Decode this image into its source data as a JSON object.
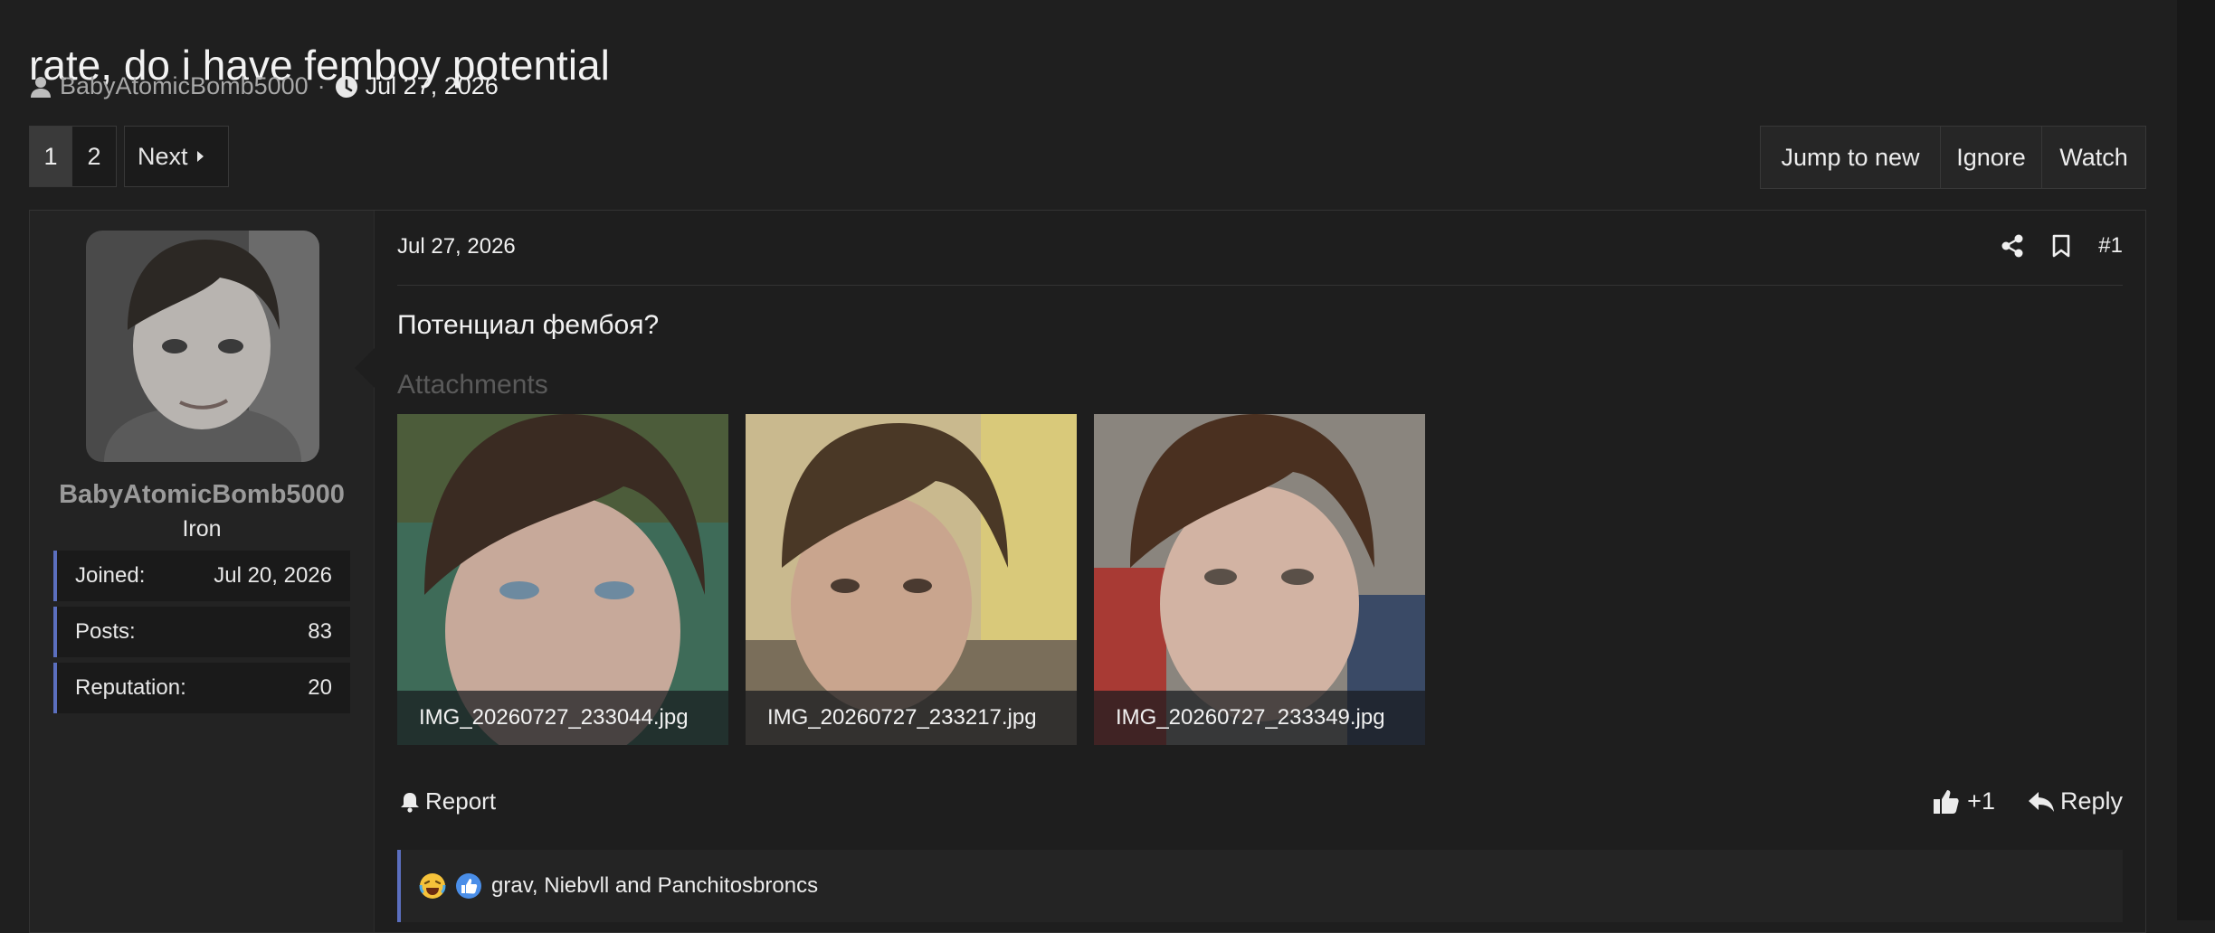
{
  "thread": {
    "title": "rate, do i have femboy potential",
    "author": "BabyAtomicBomb5000",
    "separator": "·",
    "date": "Jul 27, 2026"
  },
  "pagination": {
    "pages": [
      "1",
      "2"
    ],
    "current": "1",
    "next_label": "Next"
  },
  "thread_actions": {
    "jump_label": "Jump to new",
    "ignore_label": "Ignore",
    "watch_label": "Watch"
  },
  "post_user": {
    "name": "BabyAtomicBomb5000",
    "rank": "Iron",
    "stats": [
      {
        "label": "Joined:",
        "value": "Jul 20, 2026"
      },
      {
        "label": "Posts:",
        "value": "83"
      },
      {
        "label": "Reputation:",
        "value": "20"
      }
    ]
  },
  "post": {
    "date": "Jul 27, 2026",
    "number": "#1",
    "body": "Потенциал фембоя?",
    "attachments_label": "Attachments",
    "attachments": [
      {
        "filename": "IMG_20260727_233044.jpg"
      },
      {
        "filename": "IMG_20260727_233217.jpg"
      },
      {
        "filename": "IMG_20260727_233349.jpg"
      }
    ],
    "report_label": "Report",
    "like_label": "+1",
    "reply_label": "Reply",
    "reactions_text": "grav, Niebvll and Panchitosbroncs"
  },
  "icons": {
    "author": "user-icon",
    "date": "clock-icon",
    "share": "share-icon",
    "bookmark": "bookmark-icon",
    "report": "bell-icon",
    "like": "thumbs-up-icon",
    "reply": "reply-icon",
    "reaction_laugh": "laugh-cry-emoji-icon",
    "reaction_like": "like-reaction-icon"
  },
  "colors": {
    "background": "#1f1f1f",
    "accent": "#5b6fbf",
    "muted_text": "#9a9a9a"
  }
}
